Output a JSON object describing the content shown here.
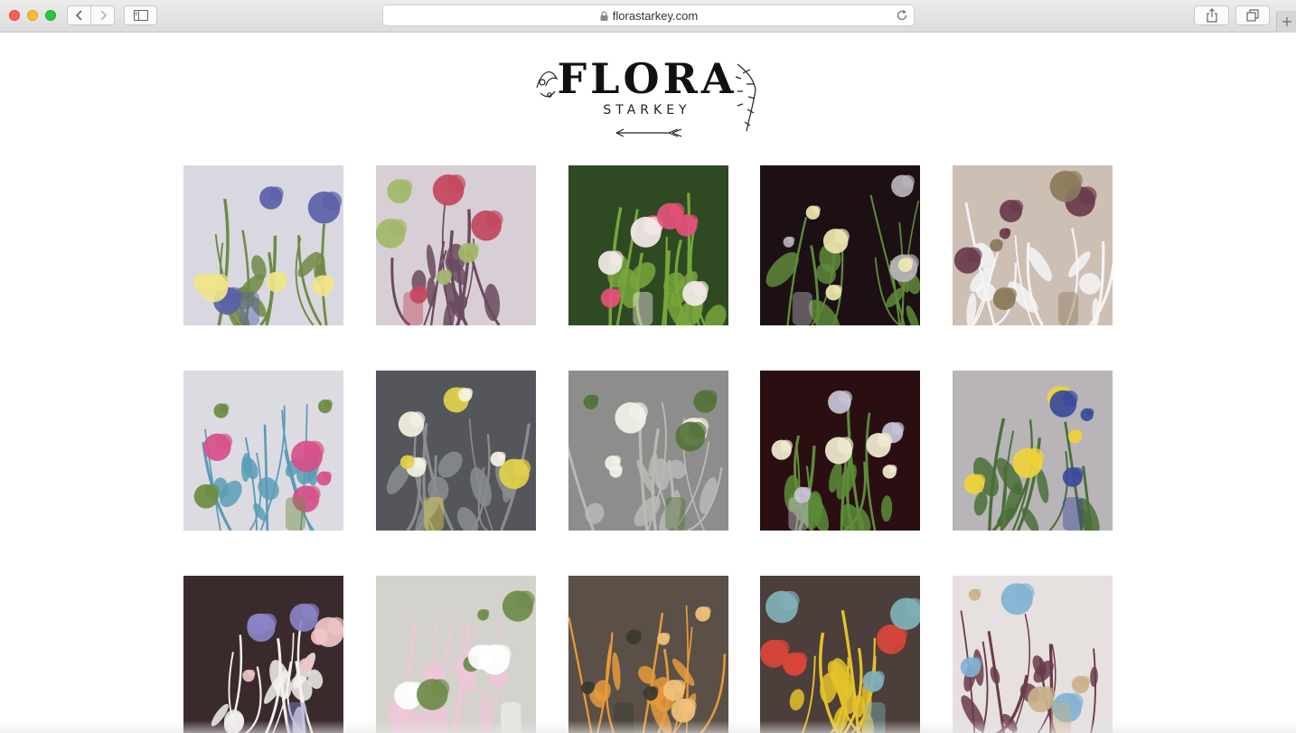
{
  "browser": {
    "url": "florastarkey.com",
    "icons": {
      "back": "chevron-left-icon",
      "forward": "chevron-right-icon",
      "sidebar": "sidebar-icon",
      "lock": "lock-icon",
      "reload": "reload-icon",
      "share": "share-icon",
      "tabs": "tabs-icon",
      "new_tab": "plus-icon"
    }
  },
  "logo": {
    "title": "FLORA",
    "subtitle": "STARKEY"
  },
  "gallery": {
    "columns": 5,
    "visible_rows": 3,
    "items": [
      {
        "subject": "daffodils and bluebells",
        "palette": [
          "#d9d7e0",
          "#6f8a44",
          "#efe58a",
          "#5b5fa8"
        ]
      },
      {
        "subject": "fritillaries by a mirror",
        "palette": [
          "#d8cfd6",
          "#6a4a5e",
          "#a3b86a",
          "#c34760"
        ]
      },
      {
        "subject": "bleeding heart stems",
        "palette": [
          "#2f4a22",
          "#78a63c",
          "#e3517a",
          "#f3eaea"
        ]
      },
      {
        "subject": "tulips in glass vases on dark",
        "palette": [
          "#1c1014",
          "#5f8a3a",
          "#efe7b0",
          "#b8b4bc"
        ]
      },
      {
        "subject": "orchids and white fabric",
        "palette": [
          "#cdbfb4",
          "#f4f4f6",
          "#6a3b4c",
          "#8a7a5a"
        ]
      },
      {
        "subject": "narcissus in pink cup",
        "palette": [
          "#dcdbe2",
          "#5a9cb6",
          "#d5508a",
          "#6e8b42"
        ]
      },
      {
        "subject": "white tulip",
        "palette": [
          "#55565c",
          "#8a8c90",
          "#f4f2e4",
          "#e2d24a"
        ]
      },
      {
        "subject": "white bell flower in glass",
        "palette": [
          "#8d8e8c",
          "#b9bab6",
          "#f1f2e8",
          "#55723a"
        ]
      },
      {
        "subject": "species tulips on dark",
        "palette": [
          "#2a0e12",
          "#5c8c3a",
          "#f2ecd2",
          "#c9c5d8"
        ]
      },
      {
        "subject": "poppies and iris",
        "palette": [
          "#b8b4b8",
          "#4a6f38",
          "#f0d23a",
          "#3b4a9a"
        ]
      },
      {
        "subject": "peony and ranunculus",
        "palette": [
          "#3a2a2c",
          "#f3f1ee",
          "#f0c6c8",
          "#8a83c6"
        ]
      },
      {
        "subject": "sweet pea arrangement",
        "palette": [
          "#d4d2cc",
          "#eec7d8",
          "#6e8b4a",
          "#ffffff"
        ]
      },
      {
        "subject": "orange lilies by mirror",
        "palette": [
          "#5a5048",
          "#e69a3a",
          "#f2c27a",
          "#3a3a2c"
        ]
      },
      {
        "subject": "tulips in colored bottles",
        "palette": [
          "#4c3e3a",
          "#e4c22a",
          "#d9453a",
          "#7fb2b8"
        ]
      },
      {
        "subject": "mantle with candle and orchid",
        "palette": [
          "#e6e0df",
          "#6a3b4a",
          "#7fb3d2",
          "#c9b28a"
        ]
      }
    ]
  }
}
